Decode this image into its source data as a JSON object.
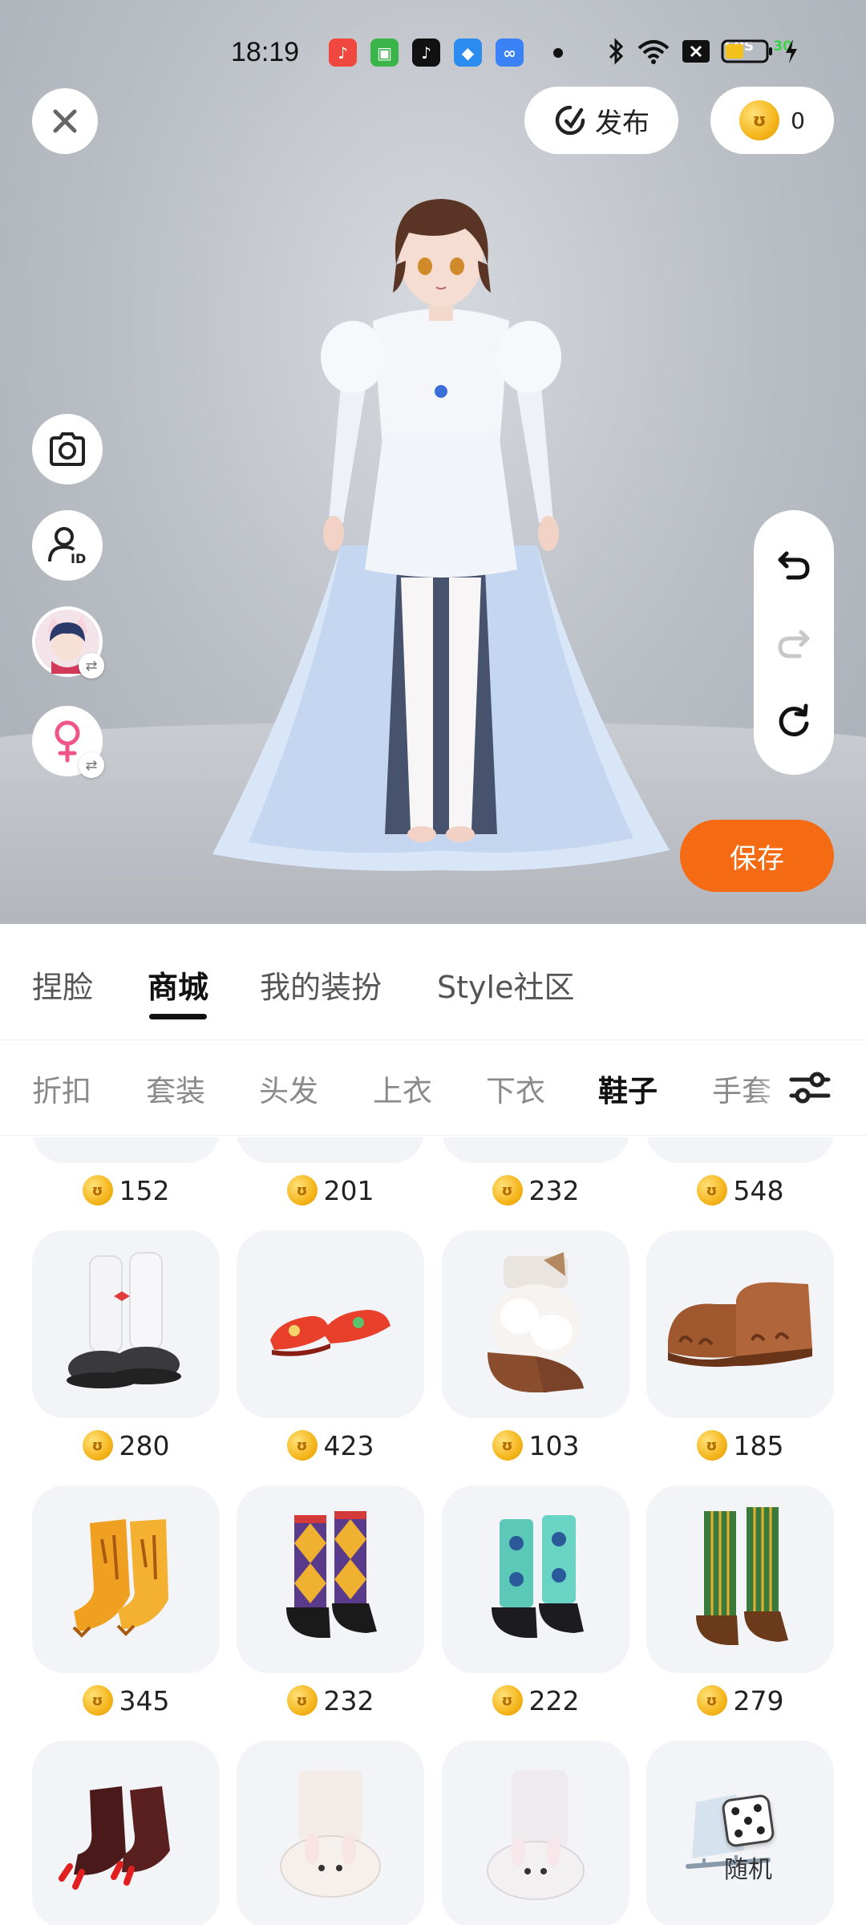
{
  "status_bar": {
    "time": "18:19",
    "fps_label": "FPS",
    "fps_value": "30",
    "apps": [
      {
        "icon": "music-app-icon",
        "color": "#f0483e"
      },
      {
        "icon": "android-app-icon",
        "color": "#39b54a"
      },
      {
        "icon": "tiktok-app-icon",
        "color": "#111111"
      },
      {
        "icon": "browser-app-icon",
        "color": "#2d8cf0"
      },
      {
        "icon": "infinity-app-icon",
        "color": "#3b82f6"
      }
    ]
  },
  "top_bar": {
    "publish_label": "发布",
    "coin_balance": "0"
  },
  "save_label": "保存",
  "tabs_main": [
    {
      "label": "捏脸",
      "active": false
    },
    {
      "label": "商城",
      "active": true
    },
    {
      "label": "我的装扮",
      "active": false
    },
    {
      "label": "Style社区",
      "active": false
    }
  ],
  "tabs_category": [
    {
      "label": "折扣",
      "active": false
    },
    {
      "label": "套装",
      "active": false
    },
    {
      "label": "头发",
      "active": false
    },
    {
      "label": "上衣",
      "active": false
    },
    {
      "label": "下衣",
      "active": false
    },
    {
      "label": "鞋子",
      "active": true
    },
    {
      "label": "手套",
      "active": false
    }
  ],
  "items": [
    {
      "price": "152",
      "icon": "shoe-item-icon"
    },
    {
      "price": "201",
      "icon": "shoe-item-icon"
    },
    {
      "price": "232",
      "icon": "shoe-item-icon"
    },
    {
      "price": "548",
      "icon": "shoe-item-icon"
    },
    {
      "price": "280",
      "icon": "white-legwarmer-platform-shoe-icon",
      "color": "#e8e8ee"
    },
    {
      "price": "423",
      "icon": "red-flat-shoe-icon",
      "color": "#e8402a"
    },
    {
      "price": "103",
      "icon": "fluffy-brown-boot-icon",
      "color": "#8a4e2e"
    },
    {
      "price": "185",
      "icon": "brown-paw-slipper-icon",
      "color": "#a0582e"
    },
    {
      "price": "345",
      "icon": "orange-paw-boot-icon",
      "color": "#f0a020"
    },
    {
      "price": "232",
      "icon": "argyle-sock-shoe-icon",
      "color": "#5a3a8a"
    },
    {
      "price": "222",
      "icon": "teal-sock-shoe-icon",
      "color": "#5cc8b8"
    },
    {
      "price": "279",
      "icon": "green-striped-boot-icon",
      "color": "#3a7a3a"
    },
    {
      "price": null,
      "icon": "red-claw-boot-icon",
      "color": "#4a1a1a"
    },
    {
      "price": null,
      "icon": "white-bunny-slipper-icon",
      "color": "#f4ece6"
    },
    {
      "price": null,
      "icon": "white-bunny-slipper-icon",
      "color": "#eeeaee"
    },
    {
      "price": null,
      "icon": "ice-skate-icon",
      "color": "#d6e2ee"
    }
  ],
  "random_label": "随机"
}
